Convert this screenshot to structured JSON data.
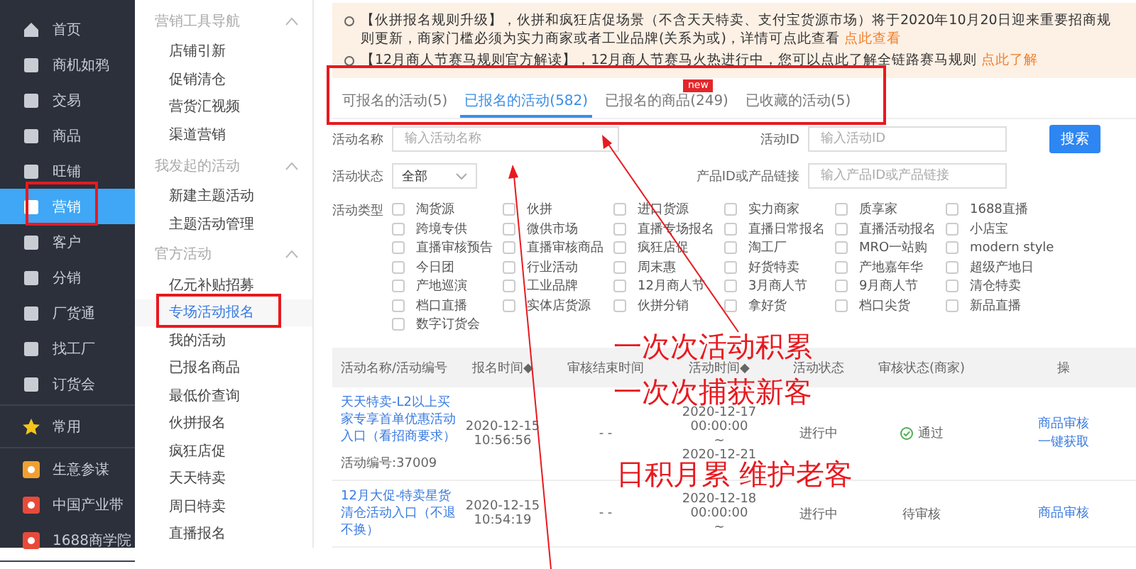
{
  "nav": {
    "groups": [
      [
        {
          "label": "首页",
          "selected": false
        },
        {
          "label": "商机如鸦",
          "selected": false
        },
        {
          "label": "交易",
          "selected": false
        },
        {
          "label": "商品",
          "selected": false
        },
        {
          "label": "旺铺",
          "selected": false
        },
        {
          "label": "营销",
          "selected": true
        },
        {
          "label": "客户",
          "selected": false
        },
        {
          "label": "分销",
          "selected": false
        },
        {
          "label": "厂货通",
          "selected": false
        },
        {
          "label": "找工厂",
          "selected": false
        },
        {
          "label": "订货会",
          "selected": false
        }
      ],
      [
        {
          "label": "常用",
          "selected": false
        }
      ],
      [
        {
          "label": "生意参谋",
          "selected": false
        },
        {
          "label": "中国产业带",
          "selected": false
        },
        {
          "label": "1688商学院",
          "selected": false
        }
      ]
    ]
  },
  "subnav": [
    {
      "title": "营销工具导航",
      "expanded": true,
      "items": [
        {
          "label": "店铺引新",
          "selected": false
        },
        {
          "label": "促销清仓",
          "selected": false
        },
        {
          "label": "营货汇视频",
          "selected": false
        },
        {
          "label": "渠道营销",
          "selected": false
        }
      ]
    },
    {
      "title": "我发起的活动",
      "expanded": true,
      "items": [
        {
          "label": "新建主题活动",
          "selected": false
        },
        {
          "label": "主题活动管理",
          "selected": false
        }
      ]
    },
    {
      "title": "官方活动",
      "expanded": true,
      "items": [
        {
          "label": "亿元补贴招募",
          "selected": false
        },
        {
          "label": "专场活动报名",
          "selected": true
        },
        {
          "label": "我的活动",
          "selected": false
        },
        {
          "label": "已报名商品",
          "selected": false
        },
        {
          "label": "最低价查询",
          "selected": false
        },
        {
          "label": "伙拼报名",
          "selected": false
        },
        {
          "label": "疯狂店促",
          "selected": false
        },
        {
          "label": "天天特卖",
          "selected": false
        },
        {
          "label": "周日特卖",
          "selected": false
        },
        {
          "label": "直播报名",
          "selected": false
        }
      ]
    }
  ],
  "notices": [
    {
      "text": "【伙拼报名规则升级】，伙拼和疯狂店促场景（不含天天特卖、支付宝货源市场）将于2020年10月20日迎来重要招商规则更新，商家门槛必须为实力商家或者工业品牌(关系为或)，详情可点此查看",
      "link": "点此查看"
    },
    {
      "text": "【12月商人节赛马规则官方解读】，12月商人节赛马火热进行中，您可以点此了解全链路赛马规则",
      "link": "点此了解"
    }
  ],
  "tabs": [
    {
      "label": "可报名的活动(5)",
      "selected": false
    },
    {
      "label": "已报名的活动(582)",
      "selected": true
    },
    {
      "label": "已报名的商品(249)",
      "selected": false,
      "badge": "new"
    },
    {
      "label": "已收藏的活动(5)",
      "selected": false
    }
  ],
  "filters": {
    "name": {
      "label": "活动名称",
      "placeholder": "输入活动名称"
    },
    "id": {
      "label": "活动ID",
      "placeholder": "输入活动ID"
    },
    "search_button": "搜索",
    "status": {
      "label": "活动状态",
      "value": "全部"
    },
    "product": {
      "label": "产品ID或产品链接",
      "placeholder": "输入产品ID或产品链接"
    },
    "types_label": "活动类型",
    "types": [
      {
        "label": "淘货源",
        "checked": false
      },
      {
        "label": "伙拼",
        "checked": false
      },
      {
        "label": "进口货源",
        "checked": false
      },
      {
        "label": "实力商家",
        "checked": false
      },
      {
        "label": "质享家",
        "checked": false
      },
      {
        "label": "1688直播",
        "checked": false
      },
      {
        "label": "跨境专供",
        "checked": false
      },
      {
        "label": "微供市场",
        "checked": false
      },
      {
        "label": "直播专场报名",
        "checked": false
      },
      {
        "label": "直播日常报名",
        "checked": false
      },
      {
        "label": "直播活动报名",
        "checked": false
      },
      {
        "label": "小店宝",
        "checked": false
      },
      {
        "label": "直播审核预告",
        "checked": false
      },
      {
        "label": "直播审核商品",
        "checked": false
      },
      {
        "label": "疯狂店促",
        "checked": false
      },
      {
        "label": "淘工厂",
        "checked": false
      },
      {
        "label": "MRO一站购",
        "checked": false
      },
      {
        "label": "modern style",
        "checked": false
      },
      {
        "label": "今日团",
        "checked": false
      },
      {
        "label": "行业活动",
        "checked": false
      },
      {
        "label": "周末惠",
        "checked": false
      },
      {
        "label": "好货特卖",
        "checked": false
      },
      {
        "label": "产地嘉年华",
        "checked": false
      },
      {
        "label": "超级产地日",
        "checked": false
      },
      {
        "label": "产地巡演",
        "checked": false
      },
      {
        "label": "工业品牌",
        "checked": false
      },
      {
        "label": "12月商人节",
        "checked": false
      },
      {
        "label": "3月商人节",
        "checked": false
      },
      {
        "label": "9月商人节",
        "checked": false
      },
      {
        "label": "清仓特卖",
        "checked": false
      },
      {
        "label": "档口直播",
        "checked": false
      },
      {
        "label": "实体店货源",
        "checked": false
      },
      {
        "label": "伙拼分销",
        "checked": false
      },
      {
        "label": "拿好货",
        "checked": false
      },
      {
        "label": "档口尖货",
        "checked": false
      },
      {
        "label": "新品直播",
        "checked": false
      },
      {
        "label": "数字订货会",
        "checked": false
      }
    ]
  },
  "table": {
    "columns": [
      "活动名称/活动编号",
      "报名时间◆",
      "审核结束时间",
      "活动时间◆",
      "活动状态",
      "审核状态(商家)",
      "操"
    ],
    "rows": [
      {
        "name": "天天特卖-L2以上买家专享首单优惠活动入口（看招商要求）",
        "number": "活动编号:37009",
        "signup": [
          "2020-12-15",
          "10:56:56"
        ],
        "audit_end": "- -",
        "period": [
          "2020-12-17",
          "00:00:00",
          "~",
          "2020-12-21"
        ],
        "status": "进行中",
        "audit": {
          "text": "通过",
          "passed": true
        },
        "actions": [
          "商品审核",
          "一键获取"
        ]
      },
      {
        "name": "12月大促-特卖星货清仓活动入口（不退不换）",
        "signup": [
          "2020-12-15",
          "10:54:19"
        ],
        "audit_end": "- -",
        "period": [
          "2020-12-18",
          "00:00:00",
          "~"
        ],
        "status": "进行中",
        "audit": {
          "text": "待审核",
          "passed": false
        },
        "actions": [
          "商品审核"
        ]
      }
    ]
  },
  "annotations": [
    "一次次活动积累",
    "一次次捕获新客",
    "日积月累 维护老客"
  ]
}
